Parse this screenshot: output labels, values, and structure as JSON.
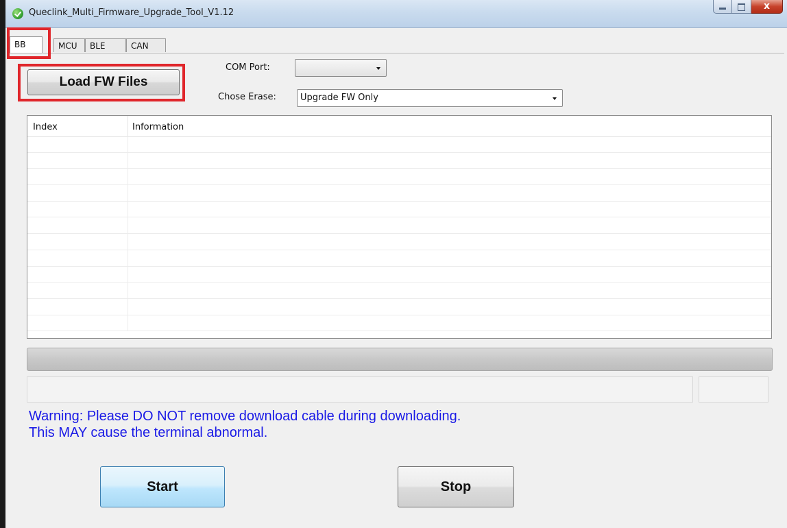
{
  "window": {
    "title": "Queclink_Multi_Firmware_Upgrade_Tool_V1.12",
    "minimize_label": "",
    "maximize_label": "",
    "close_label": "x"
  },
  "tabs": [
    {
      "label": "BB",
      "active": true
    },
    {
      "label": "MCU",
      "active": false
    },
    {
      "label": "BLE",
      "active": false
    },
    {
      "label": "CAN",
      "active": false
    }
  ],
  "toolbar": {
    "load_label": "Load FW Files",
    "com_port_label": "COM Port:",
    "com_port_value": "",
    "erase_label": "Chose Erase:",
    "erase_value": "Upgrade FW Only"
  },
  "list": {
    "columns": [
      "Index",
      "Information"
    ],
    "rows": []
  },
  "progress": {
    "fraction": 0
  },
  "status": {
    "message": "",
    "extra": ""
  },
  "warning": {
    "line1": "Warning: Please DO NOT remove download cable during downloading.",
    "line2": "This MAY cause the terminal abnormal."
  },
  "actions": {
    "start_label": "Start",
    "stop_label": "Stop"
  },
  "colors": {
    "highlight_box": "#e0262b",
    "warning_text": "#1a1ae6",
    "start_button": "#bee6fd"
  },
  "icons": {
    "app": "app-check-icon",
    "minimize": "minimize-icon",
    "maximize": "maximize-icon",
    "close": "close-icon",
    "dropdown": "chevron-down-icon"
  }
}
